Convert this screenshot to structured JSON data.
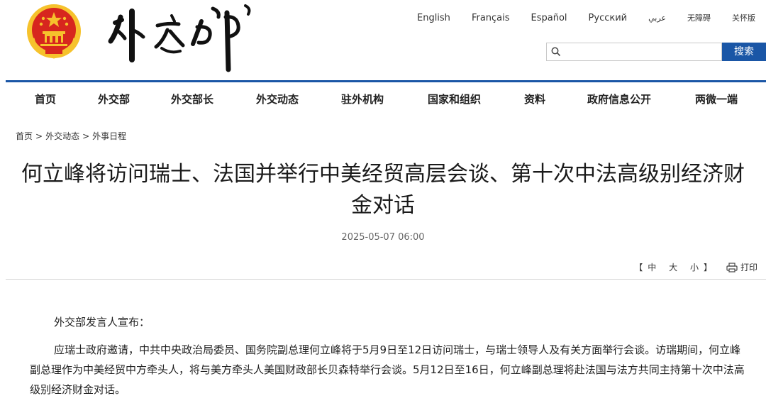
{
  "header": {
    "logo_text": "外交部",
    "languages": [
      {
        "label": "English"
      },
      {
        "label": "Français"
      },
      {
        "label": "Español"
      },
      {
        "label": "Русский"
      },
      {
        "label": "عربي"
      },
      {
        "label": "无障碍"
      },
      {
        "label": "关怀版"
      }
    ],
    "search": {
      "placeholder": "",
      "button_label": "搜索",
      "icon": "search-icon"
    }
  },
  "colors": {
    "accent": "#1a56a6",
    "emblem_red": "#d7261e",
    "emblem_gold": "#f6c22c"
  },
  "nav": {
    "items": [
      {
        "label": "首页"
      },
      {
        "label": "外交部"
      },
      {
        "label": "外交部长"
      },
      {
        "label": "外交动态"
      },
      {
        "label": "驻外机构"
      },
      {
        "label": "国家和组织"
      },
      {
        "label": "资料"
      },
      {
        "label": "政府信息公开"
      },
      {
        "label": "两微一端"
      }
    ]
  },
  "breadcrumb": {
    "items": [
      "首页",
      "外交动态",
      "外事日程"
    ],
    "separator": ">"
  },
  "article": {
    "title": "何立峰将访问瑞士、法国并举行中美经贸高层会谈、第十次中法高级别经济财金对话",
    "date": "2025-05-07 06:00",
    "font_size": {
      "open": "【",
      "large": "大",
      "medium": "中",
      "small": "小",
      "close": "】"
    },
    "print_label": "打印",
    "paragraphs": [
      "外交部发言人宣布：",
      "应瑞士政府邀请，中共中央政治局委员、国务院副总理何立峰将于5月9日至12日访问瑞士，与瑞士领导人及有关方面举行会谈。访瑞期间，何立峰副总理作为中美经贸中方牵头人，将与美方牵头人美国财政部长贝森特举行会谈。5月12日至16日，何立峰副总理将赴法国与法方共同主持第十次中法高级别经济财金对话。"
    ]
  }
}
